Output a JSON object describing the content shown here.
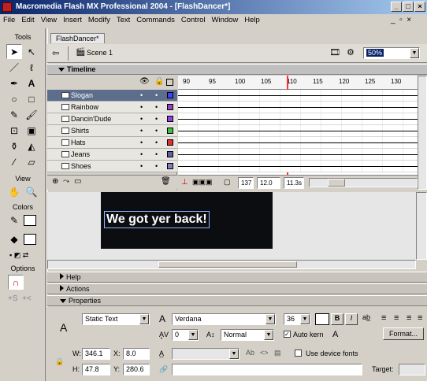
{
  "window": {
    "title": "Macromedia Flash MX Professional 2004 - [FlashDancer*]"
  },
  "menu": [
    "File",
    "Edit",
    "View",
    "Insert",
    "Modify",
    "Text",
    "Commands",
    "Control",
    "Window",
    "Help"
  ],
  "tools": {
    "label": "Tools",
    "view_label": "View",
    "colors_label": "Colors",
    "options_label": "Options"
  },
  "document": {
    "tab": "FlashDancer*",
    "scene": "Scene 1",
    "zoom": "50%"
  },
  "timeline": {
    "label": "Timeline",
    "frame_numbers": [
      "90",
      "95",
      "100",
      "105",
      "110",
      "115",
      "120",
      "125",
      "130"
    ],
    "layers": [
      {
        "name": "Slogan",
        "color": "#4040ff",
        "selected": true
      },
      {
        "name": "Rainbow",
        "color": "#9a40c0"
      },
      {
        "name": "Dancin'Dude",
        "color": "#9040e0"
      },
      {
        "name": "Shirts",
        "color": "#40c040"
      },
      {
        "name": "Hats",
        "color": "#e03030"
      },
      {
        "name": "Jeans",
        "color": "#6060a0"
      },
      {
        "name": "Shoes",
        "color": "#8080c0"
      }
    ],
    "status": {
      "frame": "137",
      "fps": "12.0 fps",
      "time": "11.3s"
    }
  },
  "stage": {
    "slogan_text": "We got yer back!"
  },
  "panels": {
    "help": "Help",
    "actions": "Actions",
    "properties": "Properties"
  },
  "properties": {
    "text_type": "Static Text",
    "font": "Verdana",
    "size": "36",
    "bold": "B",
    "italic": "I",
    "letter_spacing": "0",
    "char_position": "Normal",
    "auto_kern": "Auto kern",
    "format_button": "Format...",
    "w_label": "W:",
    "w": "346.1",
    "x_label": "X:",
    "x": "8.0",
    "h_label": "H:",
    "h": "47.8",
    "y_label": "Y:",
    "y": "280.6",
    "use_device_fonts": "Use device fonts",
    "target_label": "Target:"
  }
}
